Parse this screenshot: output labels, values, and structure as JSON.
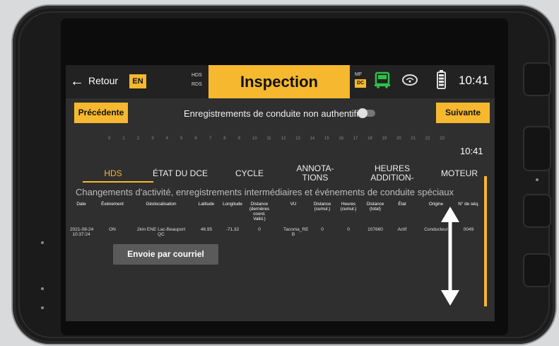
{
  "topbar": {
    "back_label": "Retour",
    "lang": "EN",
    "hds": "HDS",
    "rds": "RDS",
    "title": "Inspection",
    "mf": "MF",
    "dc": "DC",
    "time": "10:41",
    "accent_color": "#f5b82e"
  },
  "nav": {
    "prev_label": "Précédente",
    "center_text": "Enregistrements de conduite non authentifiés",
    "next_label": "Suivante"
  },
  "timeline": {
    "hours": [
      "0",
      "1",
      "2",
      "3",
      "4",
      "5",
      "6",
      "7",
      "8",
      "9",
      "10",
      "11",
      "12",
      "13",
      "14",
      "15",
      "16",
      "17",
      "18",
      "19",
      "20",
      "21",
      "22",
      "23"
    ],
    "clock": "10:41"
  },
  "tabs": [
    "HDS",
    "ÉTAT DU DCE",
    "CYCLE",
    "ANNOTA-\nTIONS",
    "HEURES\nADDITION-",
    "MOTEUR"
  ],
  "section_heading": "Changements d'activité, enregistrements intermédiaires et événements de conduite spéciaux",
  "table": {
    "headers": [
      "Date",
      "Événement",
      "Géolocalisation",
      "Latitude",
      "Longitude",
      "Distance\n(dernières\ncoord.\nValid.)",
      "VU",
      "Distance\n(cumul.)",
      "Heures\n(cumul.)",
      "Distance\n(total)",
      "État",
      "Origine",
      "N° de séq."
    ],
    "rows": [
      [
        "2021-08-24\n10:37:24",
        "ON",
        "2km ENE Lac-Beauport\nQC",
        "46.95",
        "-71.32",
        "0",
        "Tacoma_RE\nB",
        "0",
        "0",
        "107660",
        "Actif",
        "Conducteur",
        "0049"
      ]
    ]
  },
  "email_button": "Envoie par courriel"
}
